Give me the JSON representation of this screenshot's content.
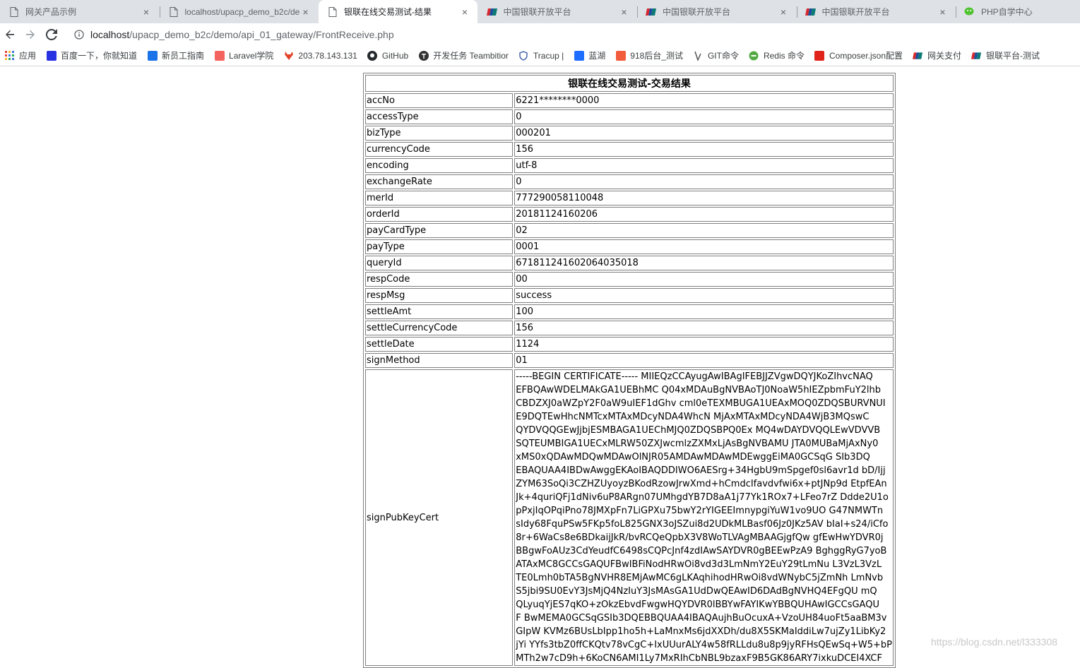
{
  "browser": {
    "tabs": [
      {
        "title": "网关产品示例",
        "active": false,
        "icon": "page-icon"
      },
      {
        "title": "localhost/upacp_demo_b2c/de",
        "active": false,
        "icon": "page-icon"
      },
      {
        "title": "银联在线交易测试-结果",
        "active": true,
        "icon": "page-icon"
      },
      {
        "title": "中国银联开放平台",
        "active": false,
        "icon": "unionpay-icon"
      },
      {
        "title": "中国银联开放平台",
        "active": false,
        "icon": "unionpay-icon"
      },
      {
        "title": "中国银联开放平台",
        "active": false,
        "icon": "unionpay-icon"
      },
      {
        "title": "PHP自学中心",
        "active": false,
        "icon": "wechat-icon"
      }
    ],
    "url_host": "localhost",
    "url_path": "/upacp_demo_b2c/demo/api_01_gateway/FrontReceive.php",
    "bookmarks": [
      {
        "label": "应用",
        "icon": "apps-grid-icon",
        "color": "#e8453c"
      },
      {
        "label": "百度一下，你就知道",
        "icon": "baidu-paw-icon",
        "color": "#2932e1"
      },
      {
        "label": "新员工指南",
        "icon": "edit-note-icon",
        "color": "#1a73e8"
      },
      {
        "label": "Laravel学院",
        "icon": "laravel-icon",
        "color": "#f4645f"
      },
      {
        "label": "203.78.143.131",
        "icon": "gitlab-fox-icon",
        "color": "#e24329"
      },
      {
        "label": "GitHub",
        "icon": "github-icon",
        "color": "#24292e"
      },
      {
        "label": "开发任务 Teambitior",
        "icon": "teambition-icon",
        "color": "#333333"
      },
      {
        "label": "Tracup |",
        "icon": "tracup-shield-icon",
        "color": "#3b5ba5"
      },
      {
        "label": "蓝湖",
        "icon": "lanhu-icon",
        "color": "#1e6fff"
      },
      {
        "label": "918后台_测试",
        "icon": "918-icon",
        "color": "#f25c3c"
      },
      {
        "label": "GIT命令",
        "icon": "git-branch-icon",
        "color": "#555555"
      },
      {
        "label": "Redis 命令",
        "icon": "redis-icon",
        "color": "#55aa44"
      },
      {
        "label": "Composer.json配置",
        "icon": "composer-c-icon",
        "color": "#e0241b"
      },
      {
        "label": "网关支付",
        "icon": "unionpay-icon",
        "color": "#1a4e9c"
      },
      {
        "label": "银联平台-测试",
        "icon": "unionpay-icon",
        "color": "#1a4e9c"
      }
    ]
  },
  "table": {
    "title": "银联在线交易测试-交易结果",
    "rows": [
      {
        "key": "accNo",
        "value": "6221********0000"
      },
      {
        "key": "accessType",
        "value": "0"
      },
      {
        "key": "bizType",
        "value": "000201"
      },
      {
        "key": "currencyCode",
        "value": "156"
      },
      {
        "key": "encoding",
        "value": "utf-8"
      },
      {
        "key": "exchangeRate",
        "value": "0"
      },
      {
        "key": "merId",
        "value": "777290058110048"
      },
      {
        "key": "orderId",
        "value": "20181124160206"
      },
      {
        "key": "payCardType",
        "value": "02"
      },
      {
        "key": "payType",
        "value": "0001"
      },
      {
        "key": "queryId",
        "value": "671811241602064035018"
      },
      {
        "key": "respCode",
        "value": "00"
      },
      {
        "key": "respMsg",
        "value": "success"
      },
      {
        "key": "settleAmt",
        "value": "100"
      },
      {
        "key": "settleCurrencyCode",
        "value": "156"
      },
      {
        "key": "settleDate",
        "value": "1124"
      },
      {
        "key": "signMethod",
        "value": "01"
      }
    ],
    "cert_key": "signPubKeyCert",
    "cert_lines": [
      "-----BEGIN CERTIFICATE----- MIIEQzCCAyugAwIBAgIFEBJJZVgwDQYJKoZIhvcNAQ",
      "EFBQAwWDELMAkGA1UEBhMC Q04xMDAuBgNVBAoTJ0NoaW5hIEZpbmFuY2lhb",
      "CBDZXJ0aWZpY2F0aW9uIEF1dGhv cml0eTEXMBUGA1UEAxMOQ0ZDQSBURVNUI",
      "E9DQTEwHhcNMTcxMTAxMDcyNDA4WhcN MjAxMTAxMDcyNDA4WjB3MQswC",
      "QYDVQQGEwJjbjESMBAGA1UEChMJQ0ZDQSBPQ0Ex MQ4wDAYDVQQLEwVDVVB",
      "SQTEUMBIGA1UECxMLRW50ZXJwcmlzZXMxLjAsBgNVBAMU JTA0MUBaMjAxNy0",
      "xMS0xQDAwMDQwMDAwOlNJR05AMDAwMDAwMDEwggEiMA0GCSqG SIb3DQ",
      "EBAQUAA4IBDwAwggEKAoIBAQDDIWO6AESrg+34HgbU9mSpgef0sl6avr1d bD/Ijj",
      "ZYM63SoQi3CZHZUyoyzBKodRzowJrwXmd+hCmdcIfavdvfwi6x+ptJNp9d EtpfEAn",
      "Jk+4quriQFj1dNiv6uP8ARgn07UMhgdYB7D8aA1j77Yk1ROx7+LFeo7rZ Ddde2U1o",
      "pPxjIqOPqiPno78JMXpFn7LiGPXu75bwY2rYIGEEImnypgiYuW1vo9UO G47NMWTn",
      "sIdy68FquPSw5FKp5foL825GNX3oJSZui8d2UDkMLBasf06Jz0JKz5AV bIaI+s24/iCfo",
      "8r+6WaCs8e6BDkaijJkR/bvRCQeQpbX3V8WoTLVAgMBAAGjgfQw gfEwHwYDVR0j",
      "BBgwFoAUz3CdYeudfC6498sCQPcJnf4zdIAwSAYDVR0gBEEwPzA9 BghggRyG7yoB",
      "ATAxMC8GCCsGAQUFBwIBFiNodHRwOi8vd3d3LmNmY2EuY29tLmNu L3VzL3VzL",
      "TE0Lmh0bTA5BgNVHR8EMjAwMC6gLKAqhihodHRwOi8vdWNybC5jZmNh LmNvb",
      "S5jbi9SU0EvY3JsMjQ4NzIuY3JsMAsGA1UdDwQEAwID6DAdBgNVHQ4EFgQU mQ",
      "QLyuqYjES7qKO+zOkzEbvdFwgwHQYDVR0lBBYwFAYIKwYBBQUHAwIGCCsGAQU",
      "F BwMEMA0GCSqGSIb3DQEBBQUAA4IBAQAujhBuOcuxA+VzoUH84uoFt5aaBM3v",
      "GIpW KVMz6BUsLbIpp1ho5h+LaMnxMs6jdXXDh/du8X5SKMaIddiLw7ujZy1LibKy2",
      "jYi YYfs3tbZ0ffCKQtv78vCgC+IxUUurALY4w58fRLLdu8u8p9jyRFHsQEwSq+W5+bP",
      "MTh2w7cD9h+6KoCN6AMI1Ly7MxRIhCbNBL9bzaxF9B5GK86ARY7ixkuDCEI4XCF"
    ]
  },
  "watermark": "https://blog.csdn.net/l333308"
}
